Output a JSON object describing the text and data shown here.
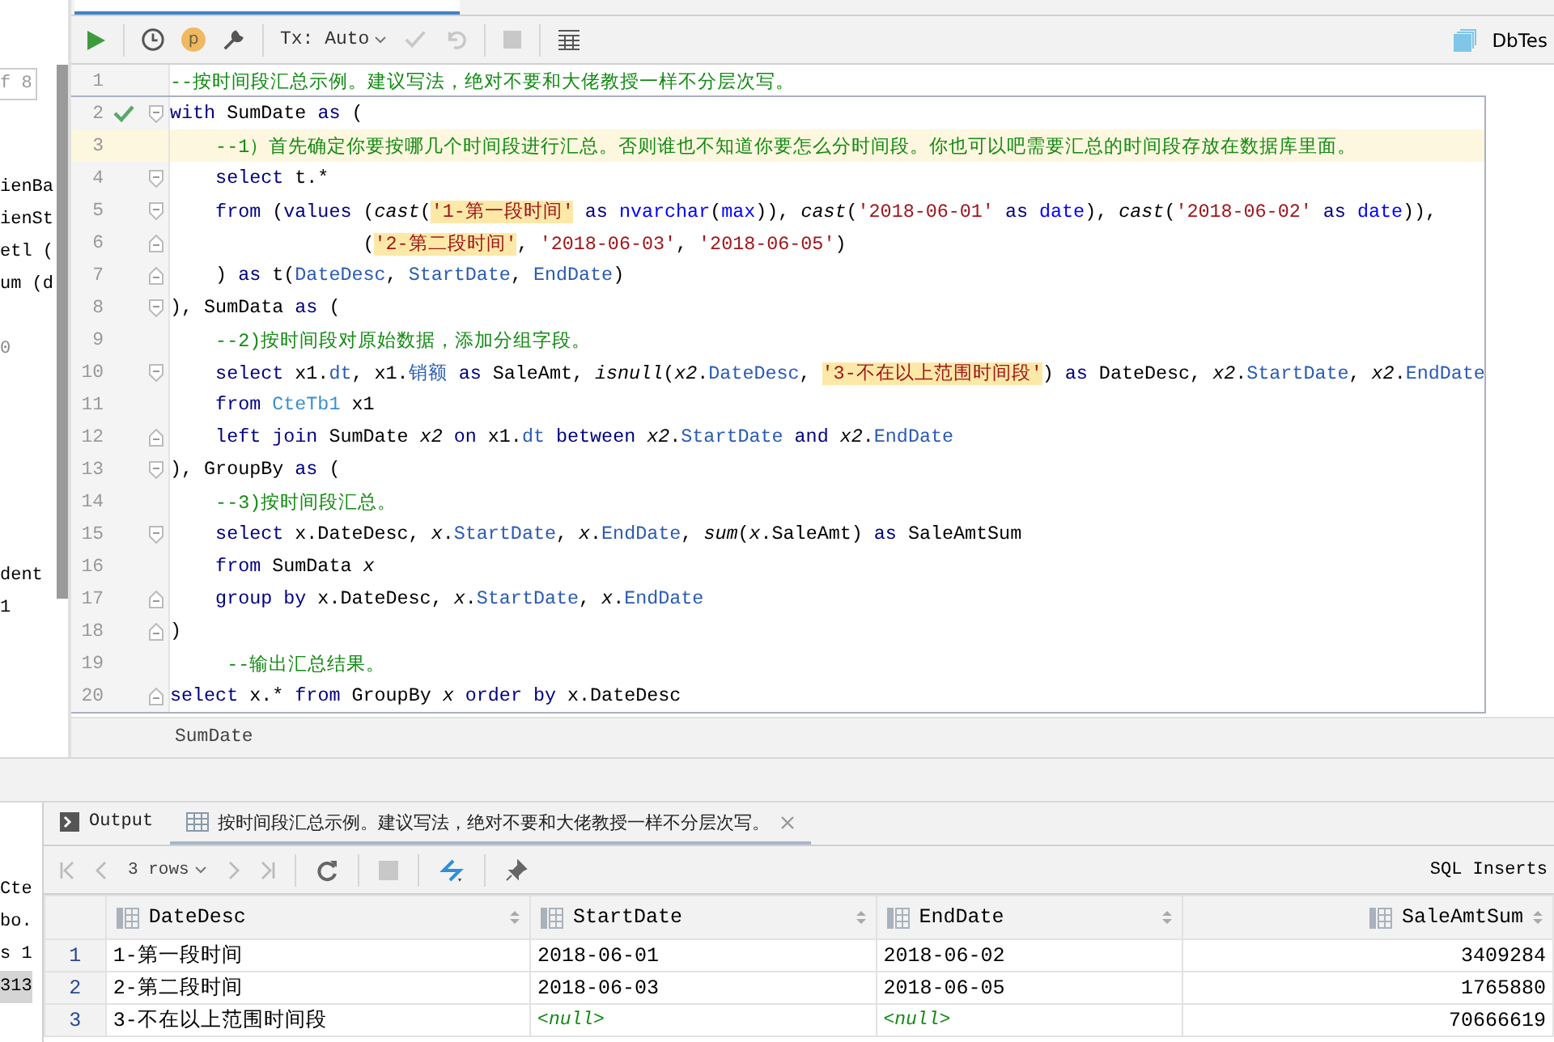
{
  "left_panel": {
    "items": [
      {
        "text": "f 8",
        "kind": "field"
      },
      {
        "text": "ienBa",
        "kind": "item"
      },
      {
        "text": "ienSt",
        "kind": "item"
      },
      {
        "text": "etl (",
        "kind": "item"
      },
      {
        "text": "um (d",
        "kind": "item"
      },
      {
        "text": "0",
        "kind": "item"
      },
      {
        "text": "dent",
        "kind": "item"
      },
      {
        "text": "1",
        "kind": "item"
      }
    ]
  },
  "toolbar": {
    "tx_mode": "Tx: Auto",
    "commit_disabled": true,
    "rollback_disabled": true,
    "stop_disabled": true,
    "profile_label": "p"
  },
  "datasource": "DbTes",
  "editor": {
    "lines": [
      {
        "number": "1",
        "in_statement": false,
        "current": false,
        "executed": false,
        "fold_start": false,
        "fold_end": false,
        "tokens": [
          {
            "kind": "cmt",
            "text": "--按时间段汇总示例。建议写法，绝对不要和大佬教授一样不分层次写。"
          }
        ]
      },
      {
        "number": "2",
        "in_statement": true,
        "current": false,
        "executed": true,
        "fold_start": true,
        "fold_end": false,
        "tokens": [
          {
            "kind": "kw",
            "text": "with"
          },
          {
            "kind": "plain",
            "text": " SumDate "
          },
          {
            "kind": "kw",
            "text": "as"
          },
          {
            "kind": "plain",
            "text": " ("
          }
        ]
      },
      {
        "number": "3",
        "in_statement": true,
        "current": true,
        "executed": false,
        "fold_start": false,
        "fold_end": false,
        "tokens": [
          {
            "kind": "cmt",
            "text": "    --1）首先确定你要按哪几个时间段进行汇总。否则谁也不知道你要怎么分时间段。你也可以吧需要汇总的时间段存放在数据库里面。"
          }
        ]
      },
      {
        "number": "4",
        "in_statement": true,
        "current": false,
        "executed": false,
        "fold_start": true,
        "fold_end": false,
        "tokens": [
          {
            "kind": "kw",
            "text": "    select"
          },
          {
            "kind": "plain",
            "text": " t.*"
          }
        ]
      },
      {
        "number": "5",
        "in_statement": true,
        "current": false,
        "executed": false,
        "fold_start": true,
        "fold_end": false,
        "tokens": [
          {
            "kind": "kw",
            "text": "    from"
          },
          {
            "kind": "plain",
            "text": " ("
          },
          {
            "kind": "kw",
            "text": "values"
          },
          {
            "kind": "plain",
            "text": " ("
          },
          {
            "kind": "fn",
            "text": "cast"
          },
          {
            "kind": "plain",
            "text": "("
          },
          {
            "kind": "strhl",
            "text": "'1-第一段时间'"
          },
          {
            "kind": "kw",
            "text": " as "
          },
          {
            "kind": "type",
            "text": "nvarchar"
          },
          {
            "kind": "plain",
            "text": "("
          },
          {
            "kind": "type",
            "text": "max"
          },
          {
            "kind": "plain",
            "text": ")), "
          },
          {
            "kind": "fn",
            "text": "cast"
          },
          {
            "kind": "plain",
            "text": "("
          },
          {
            "kind": "str",
            "text": "'2018-06-01'"
          },
          {
            "kind": "kw",
            "text": " as "
          },
          {
            "kind": "type",
            "text": "date"
          },
          {
            "kind": "plain",
            "text": "), "
          },
          {
            "kind": "fn",
            "text": "cast"
          },
          {
            "kind": "plain",
            "text": "("
          },
          {
            "kind": "str",
            "text": "'2018-06-02'"
          },
          {
            "kind": "kw",
            "text": " as "
          },
          {
            "kind": "type",
            "text": "date"
          },
          {
            "kind": "plain",
            "text": ")),"
          }
        ]
      },
      {
        "number": "6",
        "in_statement": true,
        "current": false,
        "executed": false,
        "fold_start": false,
        "fold_end": true,
        "tokens": [
          {
            "kind": "plain",
            "text": "                 ("
          },
          {
            "kind": "strhl",
            "text": "'2-第二段时间'"
          },
          {
            "kind": "plain",
            "text": ", "
          },
          {
            "kind": "str",
            "text": "'2018-06-03'"
          },
          {
            "kind": "plain",
            "text": ", "
          },
          {
            "kind": "str",
            "text": "'2018-06-05'"
          },
          {
            "kind": "plain",
            "text": ")"
          }
        ]
      },
      {
        "number": "7",
        "in_statement": true,
        "current": false,
        "executed": false,
        "fold_start": false,
        "fold_end": true,
        "tokens": [
          {
            "kind": "plain",
            "text": "    ) "
          },
          {
            "kind": "kw",
            "text": "as"
          },
          {
            "kind": "plain",
            "text": " t("
          },
          {
            "kind": "col",
            "text": "DateDesc"
          },
          {
            "kind": "plain",
            "text": ", "
          },
          {
            "kind": "col",
            "text": "StartDate"
          },
          {
            "kind": "plain",
            "text": ", "
          },
          {
            "kind": "col",
            "text": "EndDate"
          },
          {
            "kind": "plain",
            "text": ")"
          }
        ]
      },
      {
        "number": "8",
        "in_statement": true,
        "current": false,
        "executed": false,
        "fold_start": true,
        "fold_end": false,
        "tokens": [
          {
            "kind": "plain",
            "text": "), SumData "
          },
          {
            "kind": "kw",
            "text": "as"
          },
          {
            "kind": "plain",
            "text": " ("
          }
        ]
      },
      {
        "number": "9",
        "in_statement": true,
        "current": false,
        "executed": false,
        "fold_start": false,
        "fold_end": false,
        "tokens": [
          {
            "kind": "cmt",
            "text": "    --2)按时间段对原始数据，添加分组字段。"
          }
        ]
      },
      {
        "number": "10",
        "in_statement": true,
        "current": false,
        "executed": false,
        "fold_start": true,
        "fold_end": false,
        "tokens": [
          {
            "kind": "kw",
            "text": "    select"
          },
          {
            "kind": "plain",
            "text": " x1."
          },
          {
            "kind": "col",
            "text": "dt"
          },
          {
            "kind": "plain",
            "text": ", x1."
          },
          {
            "kind": "col",
            "text": "销额"
          },
          {
            "kind": "kw",
            "text": " as "
          },
          {
            "kind": "plain",
            "text": "SaleAmt, "
          },
          {
            "kind": "fn",
            "text": "isnull"
          },
          {
            "kind": "plain",
            "text": "("
          },
          {
            "kind": "alias",
            "text": "x2"
          },
          {
            "kind": "plain",
            "text": "."
          },
          {
            "kind": "col",
            "text": "DateDesc"
          },
          {
            "kind": "plain",
            "text": ", "
          },
          {
            "kind": "strhl",
            "text": "'3-不在以上范围时间段'"
          },
          {
            "kind": "plain",
            "text": ") "
          },
          {
            "kind": "kw",
            "text": "as"
          },
          {
            "kind": "plain",
            "text": " DateDesc, "
          },
          {
            "kind": "alias",
            "text": "x2"
          },
          {
            "kind": "plain",
            "text": "."
          },
          {
            "kind": "col",
            "text": "StartDate"
          },
          {
            "kind": "plain",
            "text": ", "
          },
          {
            "kind": "alias",
            "text": "x2"
          },
          {
            "kind": "plain",
            "text": "."
          },
          {
            "kind": "col",
            "text": "EndDate"
          }
        ]
      },
      {
        "number": "11",
        "in_statement": true,
        "current": false,
        "executed": false,
        "fold_start": false,
        "fold_end": false,
        "tokens": [
          {
            "kind": "kw",
            "text": "    from "
          },
          {
            "kind": "tbl",
            "text": "CteTb1"
          },
          {
            "kind": "plain",
            "text": " x1"
          }
        ]
      },
      {
        "number": "12",
        "in_statement": true,
        "current": false,
        "executed": false,
        "fold_start": false,
        "fold_end": true,
        "tokens": [
          {
            "kind": "kw",
            "text": "    left join"
          },
          {
            "kind": "plain",
            "text": " SumDate "
          },
          {
            "kind": "alias",
            "text": "x2"
          },
          {
            "kind": "kw",
            "text": " on "
          },
          {
            "kind": "plain",
            "text": "x1."
          },
          {
            "kind": "col",
            "text": "dt"
          },
          {
            "kind": "kw",
            "text": " between "
          },
          {
            "kind": "alias",
            "text": "x2"
          },
          {
            "kind": "plain",
            "text": "."
          },
          {
            "kind": "col",
            "text": "StartDate"
          },
          {
            "kind": "kw",
            "text": " and "
          },
          {
            "kind": "alias",
            "text": "x2"
          },
          {
            "kind": "plain",
            "text": "."
          },
          {
            "kind": "col",
            "text": "EndDate"
          }
        ]
      },
      {
        "number": "13",
        "in_statement": true,
        "current": false,
        "executed": false,
        "fold_start": true,
        "fold_end": false,
        "tokens": [
          {
            "kind": "plain",
            "text": "), GroupBy "
          },
          {
            "kind": "kw",
            "text": "as"
          },
          {
            "kind": "plain",
            "text": " ("
          }
        ]
      },
      {
        "number": "14",
        "in_statement": true,
        "current": false,
        "executed": false,
        "fold_start": false,
        "fold_end": false,
        "tokens": [
          {
            "kind": "cmt",
            "text": "    --3)按时间段汇总。"
          }
        ]
      },
      {
        "number": "15",
        "in_statement": true,
        "current": false,
        "executed": false,
        "fold_start": true,
        "fold_end": false,
        "tokens": [
          {
            "kind": "kw",
            "text": "    select"
          },
          {
            "kind": "plain",
            "text": " x.DateDesc, "
          },
          {
            "kind": "alias",
            "text": "x"
          },
          {
            "kind": "plain",
            "text": "."
          },
          {
            "kind": "col",
            "text": "StartDate"
          },
          {
            "kind": "plain",
            "text": ", "
          },
          {
            "kind": "alias",
            "text": "x"
          },
          {
            "kind": "plain",
            "text": "."
          },
          {
            "kind": "col",
            "text": "EndDate"
          },
          {
            "kind": "plain",
            "text": ", "
          },
          {
            "kind": "fn",
            "text": "sum"
          },
          {
            "kind": "plain",
            "text": "("
          },
          {
            "kind": "alias",
            "text": "x"
          },
          {
            "kind": "plain",
            "text": ".SaleAmt) "
          },
          {
            "kind": "kw",
            "text": "as"
          },
          {
            "kind": "plain",
            "text": " SaleAmtSum"
          }
        ]
      },
      {
        "number": "16",
        "in_statement": true,
        "current": false,
        "executed": false,
        "fold_start": false,
        "fold_end": false,
        "tokens": [
          {
            "kind": "kw",
            "text": "    from"
          },
          {
            "kind": "plain",
            "text": " SumData "
          },
          {
            "kind": "alias",
            "text": "x"
          }
        ]
      },
      {
        "number": "17",
        "in_statement": true,
        "current": false,
        "executed": false,
        "fold_start": false,
        "fold_end": true,
        "tokens": [
          {
            "kind": "kw",
            "text": "    group by"
          },
          {
            "kind": "plain",
            "text": " x.DateDesc, "
          },
          {
            "kind": "alias",
            "text": "x"
          },
          {
            "kind": "plain",
            "text": "."
          },
          {
            "kind": "col",
            "text": "StartDate"
          },
          {
            "kind": "plain",
            "text": ", "
          },
          {
            "kind": "alias",
            "text": "x"
          },
          {
            "kind": "plain",
            "text": "."
          },
          {
            "kind": "col",
            "text": "EndDate"
          }
        ]
      },
      {
        "number": "18",
        "in_statement": true,
        "current": false,
        "executed": false,
        "fold_start": false,
        "fold_end": true,
        "tokens": [
          {
            "kind": "plain",
            "text": ")"
          }
        ]
      },
      {
        "number": "19",
        "in_statement": true,
        "current": false,
        "executed": false,
        "fold_start": false,
        "fold_end": false,
        "tokens": [
          {
            "kind": "cmt",
            "text": "     --输出汇总结果。"
          }
        ]
      },
      {
        "number": "20",
        "in_statement": true,
        "current": false,
        "executed": false,
        "fold_start": false,
        "fold_end": true,
        "tokens": [
          {
            "kind": "kw",
            "text": "select"
          },
          {
            "kind": "plain",
            "text": " x.* "
          },
          {
            "kind": "kw",
            "text": "from"
          },
          {
            "kind": "plain",
            "text": " GroupBy "
          },
          {
            "kind": "alias",
            "text": "x"
          },
          {
            "kind": "kw",
            "text": " order by"
          },
          {
            "kind": "plain",
            "text": " x.DateDesc"
          }
        ]
      }
    ]
  },
  "breadcrumb": "SumDate",
  "bottom_left_panel": {
    "items": [
      {
        "text": "Cte",
        "selected": false
      },
      {
        "text": "bo.",
        "selected": false
      },
      {
        "text": "s 1",
        "selected": false
      },
      {
        "text": "313",
        "selected": true
      }
    ]
  },
  "result_tabs": [
    {
      "label": "Output",
      "kind": "console",
      "selected": false
    },
    {
      "label": "按时间段汇总示例。建议写法，绝对不要和大佬教授一样不分层次写。",
      "kind": "result",
      "selected": true
    }
  ],
  "result_toolbar": {
    "rows_label": "3 rows",
    "export_format": "SQL Inserts"
  },
  "table": {
    "columns": [
      {
        "name": "DateDesc",
        "numeric": false
      },
      {
        "name": "StartDate",
        "numeric": false
      },
      {
        "name": "EndDate",
        "numeric": false
      },
      {
        "name": "SaleAmtSum",
        "numeric": true
      }
    ],
    "rows": [
      {
        "number": "1",
        "cells": [
          {
            "text": "1-第一段时间"
          },
          {
            "text": "2018-06-01"
          },
          {
            "text": "2018-06-02"
          },
          {
            "text": "3409284"
          }
        ]
      },
      {
        "number": "2",
        "cells": [
          {
            "text": "2-第二段时间"
          },
          {
            "text": "2018-06-03"
          },
          {
            "text": "2018-06-05"
          },
          {
            "text": "1765880"
          }
        ]
      },
      {
        "number": "3",
        "cells": [
          {
            "text": "3-不在以上范围时间段"
          },
          {
            "text": "<null>",
            "kind": "null"
          },
          {
            "text": "<null>",
            "kind": "null"
          },
          {
            "text": "70666619"
          }
        ]
      }
    ]
  }
}
